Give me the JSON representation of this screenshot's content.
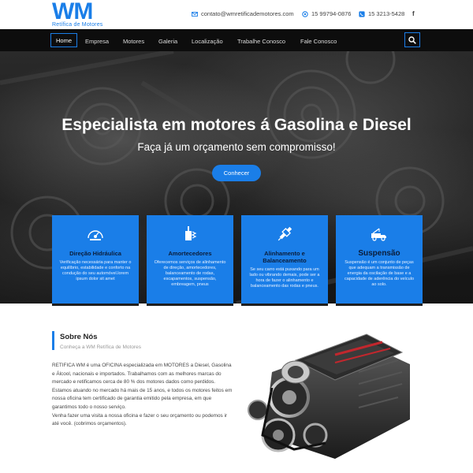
{
  "brand": {
    "logo_text": "WM",
    "logo_sub": "Retífica de Motores",
    "color": "#1a7ee8"
  },
  "topbar": {
    "email": "contato@wmretificademotores.com",
    "phone1": "15 99794-0876",
    "phone2": "15 3213-5428",
    "facebook": "f"
  },
  "nav": {
    "items": [
      {
        "label": "Home"
      },
      {
        "label": "Empresa"
      },
      {
        "label": "Motores"
      },
      {
        "label": "Galeria"
      },
      {
        "label": "Localização"
      },
      {
        "label": "Trabalhe Conosco"
      },
      {
        "label": "Fale Conosco"
      }
    ],
    "search_icon": "search-icon"
  },
  "hero": {
    "title": "Especialista em motores á Gasolina e Diesel",
    "subtitle": "Faça já um orçamento sem compromisso!",
    "button": "Conhecer"
  },
  "services": [
    {
      "icon": "speedometer-icon",
      "title": "Direção Hidráulica",
      "text": "Verificação necessária para manter o equilíbrio, estabilidade e conforto na condução do seu automóvel.lorem ipsum dolor sit amet"
    },
    {
      "icon": "shock-absorber-icon",
      "title": "Amortecedores",
      "text": "Oferecemos serviços de alinhamento de direção, amortecedores, balanceamento de rodas, escapamentos, suspensão, embreagem, pneus"
    },
    {
      "icon": "spark-plug-icon",
      "title": "Alinhamento e Balanceamento",
      "text": "Se seu carro está puxando para um lado ou vibrando demais, pode ser a hora de fazer o alinhamento e balanceamento das rodas e pneus."
    },
    {
      "icon": "tow-truck-icon",
      "title": "Suspensão",
      "text": "Suspensão é um conjunto de peças que adequam a transmissão de energia da oscilação de base e a capacidade de aderência do veículo ao solo."
    }
  ],
  "about": {
    "title": "Sobre Nós",
    "subtitle": "Conheça a WM Retífica de Motores",
    "paragraphs": [
      "RETIFICA WM é uma OFICINA especializada em MOTORES a Diesel, Gasolina e Álcool, nacionais e importados. Trabalhamos com as melhores marcas do mercado e retificamos cerca de 80 % dos motores dados como perdidos.",
      "Estamos atuando no mercado há mais de 15 anos, e todos os motores feitos em nossa oficina tem certificado de garantia emitido pela empresa, em que garantimos todo o nosso serviço.",
      "Venha fazer uma visita a nossa oficina e fazer o seu orçamento ou podemos ir até você. (cobrimos orçamentos)."
    ]
  }
}
